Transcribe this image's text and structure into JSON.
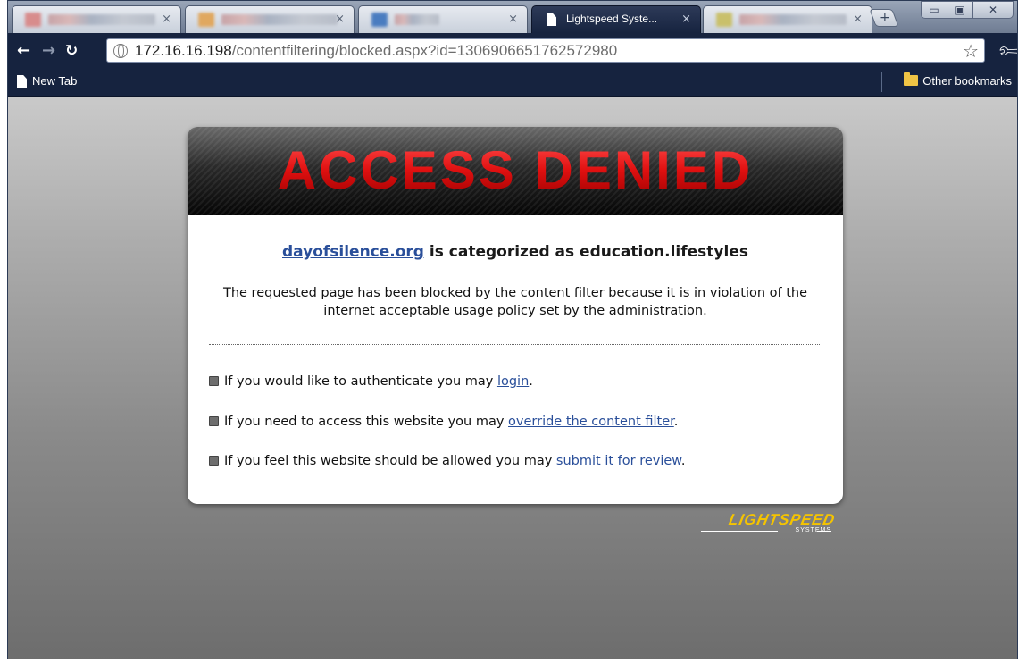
{
  "browser": {
    "active_tab_title": "Lightspeed Syste...",
    "tab_close_glyph": "×",
    "new_tab_glyph": "+",
    "window_buttons": {
      "minimize": "▭",
      "maximize": "▣",
      "close": "✕"
    },
    "url_host": "172.16.16.198",
    "url_path": "/contentfiltering/blocked.aspx?id=1306906651762572980",
    "bookmarks": {
      "left": "New Tab",
      "right": "Other bookmarks"
    }
  },
  "page": {
    "banner_title": "ACCESS DENIED",
    "site_link": "dayofsilence.org",
    "headline_rest": " is categorized as education.lifestyles",
    "description": "The requested page has been blocked by the content filter because it is in violation of the internet acceptable usage policy set by the administration.",
    "options": [
      {
        "text": "If you would like to authenticate you may ",
        "link": "login",
        "end": "."
      },
      {
        "text": "If you need to access this website you may ",
        "link": "override the content filter",
        "end": "."
      },
      {
        "text": "If you feel this website should be allowed you may ",
        "link": "submit it for review",
        "end": "."
      }
    ]
  },
  "logo": {
    "name": "LIGHTSPEED",
    "sub": "SYSTEMS"
  },
  "colors": {
    "banner_text": "#d21212",
    "link": "#2a4f9a",
    "logo": "#f5c400",
    "browser_chrome": "#16233f"
  }
}
